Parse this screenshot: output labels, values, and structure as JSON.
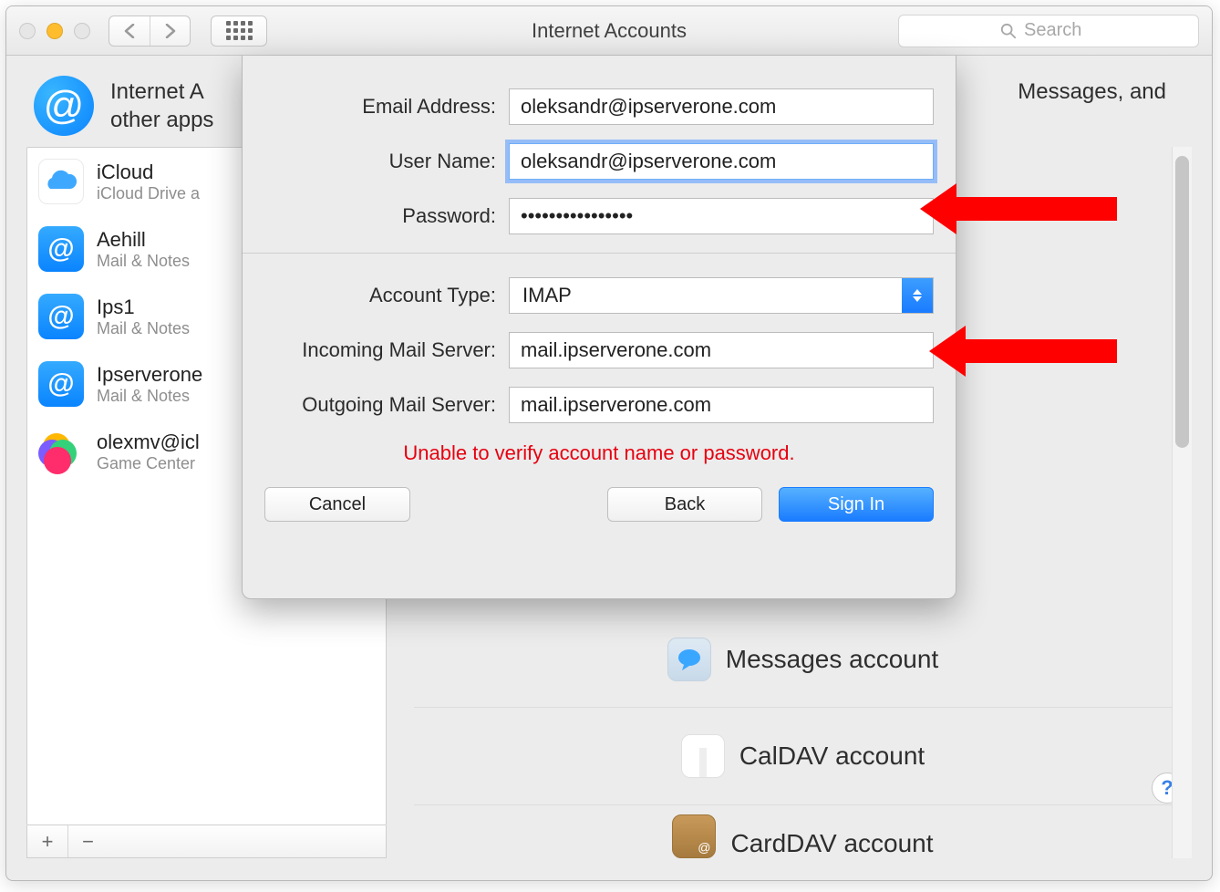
{
  "window": {
    "title": "Internet Accounts",
    "search_placeholder": "Search"
  },
  "header": {
    "text_left": "Internet A",
    "text_right": "Messages, and",
    "text_line2": "other apps"
  },
  "sidebar": {
    "items": [
      {
        "name": "iCloud",
        "sub": "iCloud Drive a"
      },
      {
        "name": "Aehill",
        "sub": "Mail & Notes"
      },
      {
        "name": "Ips1",
        "sub": "Mail & Notes"
      },
      {
        "name": "Ipserverone",
        "sub": "Mail & Notes"
      },
      {
        "name": "olexmv@icl",
        "sub": "Game Center"
      }
    ],
    "add": "+",
    "remove": "−"
  },
  "providers": {
    "messages": "Messages account",
    "caldav": "CalDAV account",
    "carddav": "CardDAV account"
  },
  "help": "?",
  "sheet": {
    "labels": {
      "email": "Email Address:",
      "username": "User Name:",
      "password": "Password:",
      "account_type": "Account Type:",
      "incoming": "Incoming Mail Server:",
      "outgoing": "Outgoing Mail Server:"
    },
    "values": {
      "email": "oleksandr@ipserverone.com",
      "username": "oleksandr@ipserverone.com",
      "password": "••••••••••••••••",
      "account_type": "IMAP",
      "incoming": "mail.ipserverone.com",
      "outgoing": "mail.ipserverone.com"
    },
    "error": "Unable to verify account name or password.",
    "buttons": {
      "cancel": "Cancel",
      "back": "Back",
      "signin": "Sign In"
    }
  }
}
